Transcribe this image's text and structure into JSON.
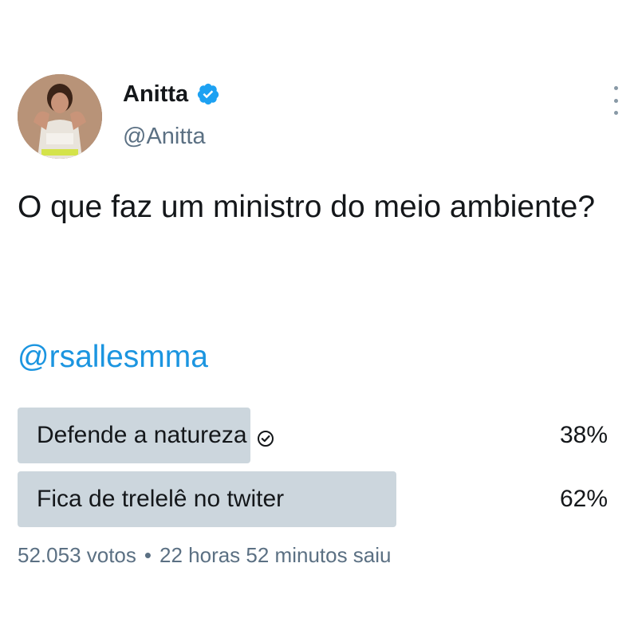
{
  "tweet": {
    "author": {
      "display_name": "Anitta",
      "handle": "@Anitta",
      "verified": true,
      "avatar_icon": "profile-photo"
    },
    "text": "O que faz um ministro do meio ambiente?",
    "mention": "@rsallesmma",
    "more_icon": "more-options-icon"
  },
  "poll": {
    "options": [
      {
        "label": "Defende a natureza",
        "percent_label": "38%",
        "percent": 38,
        "selected": true
      },
      {
        "label": "Fica de trelelê no twiter",
        "percent_label": "62%",
        "percent": 62,
        "selected": false
      }
    ],
    "votes": "52.053 votos",
    "separator": "•",
    "time_left": "22 horas 52 minutos saiu"
  },
  "colors": {
    "verified": "#1da1f2",
    "mention": "#1b95e0",
    "poll_bar": "#ccd6dd",
    "secondary_text": "#5b7083"
  }
}
